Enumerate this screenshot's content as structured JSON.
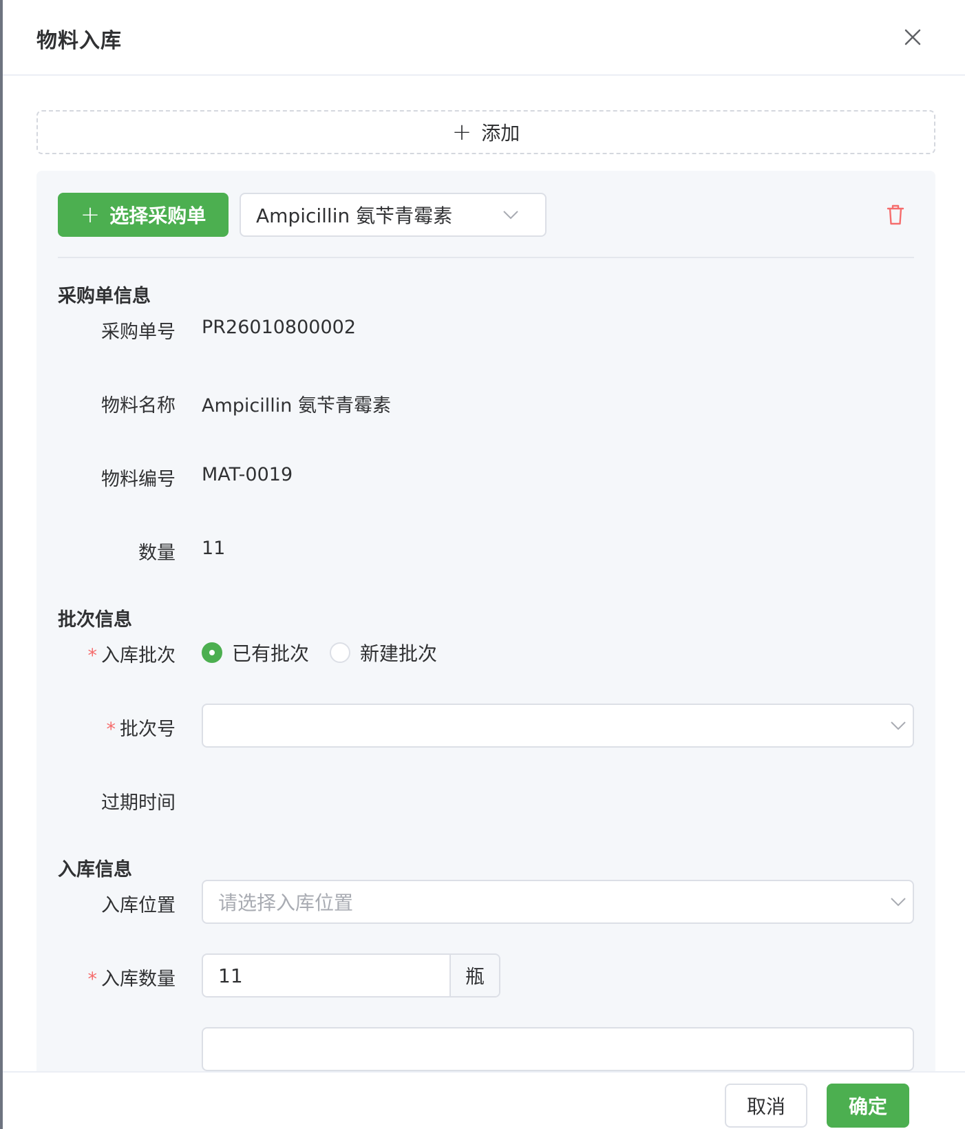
{
  "drawer": {
    "title": "物料入库",
    "close_icon": "close-icon"
  },
  "add_button": {
    "icon": "plus-icon",
    "label": "添加"
  },
  "item_card": {
    "select_po_button": {
      "icon": "plus-icon",
      "label": "选择采购单"
    },
    "material_select": {
      "value": "Ampicillin 氨苄青霉素",
      "icon": "chevron-down-icon"
    },
    "delete_icon": "trash-icon",
    "po_section": {
      "title": "采购单信息",
      "fields": [
        {
          "label": "采购单号",
          "value": "PR26010800002"
        },
        {
          "label": "物料名称",
          "value": "Ampicillin 氨苄青霉素"
        },
        {
          "label": "物料编号",
          "value": "MAT-0019"
        },
        {
          "label": "数量",
          "value": "11"
        }
      ]
    },
    "batch_section": {
      "title": "批次信息",
      "batch_type_label": "入库批次",
      "batch_options": [
        {
          "label": "已有批次",
          "checked": true
        },
        {
          "label": "新建批次",
          "checked": false
        }
      ],
      "batch_no_label": "批次号",
      "batch_no_value": "",
      "expiry_label": "过期时间",
      "expiry_value": ""
    },
    "stockin_section": {
      "title": "入库信息",
      "location_label": "入库位置",
      "location_placeholder": "请选择入库位置",
      "quantity_label": "入库数量",
      "quantity_value": "11",
      "quantity_unit": "瓶"
    }
  },
  "footer": {
    "cancel_label": "取消",
    "confirm_label": "确定"
  },
  "colors": {
    "primary": "#4caf50",
    "danger": "#f56c6c",
    "card_bg": "#f5f7fa",
    "border": "#dcdfe6",
    "placeholder": "#a8abb2"
  }
}
